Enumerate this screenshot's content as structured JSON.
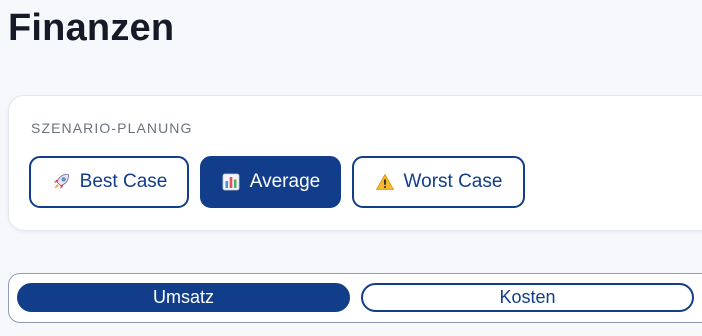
{
  "page": {
    "title": "Finanzen"
  },
  "scenario": {
    "section_label": "SZENARIO-PLANUNG",
    "active": "Average",
    "options": [
      {
        "label": "Best Case",
        "icon": "rocket-icon"
      },
      {
        "label": "Average",
        "icon": "bar-chart-icon"
      },
      {
        "label": "Worst Case",
        "icon": "warning-icon"
      }
    ]
  },
  "tabs": {
    "active": "Umsatz",
    "items": [
      {
        "label": "Umsatz"
      },
      {
        "label": "Kosten"
      }
    ]
  },
  "colors": {
    "accent": "#123d8a",
    "background": "#f7f8fb",
    "card": "#ffffff",
    "label_gray": "#6b7280"
  }
}
